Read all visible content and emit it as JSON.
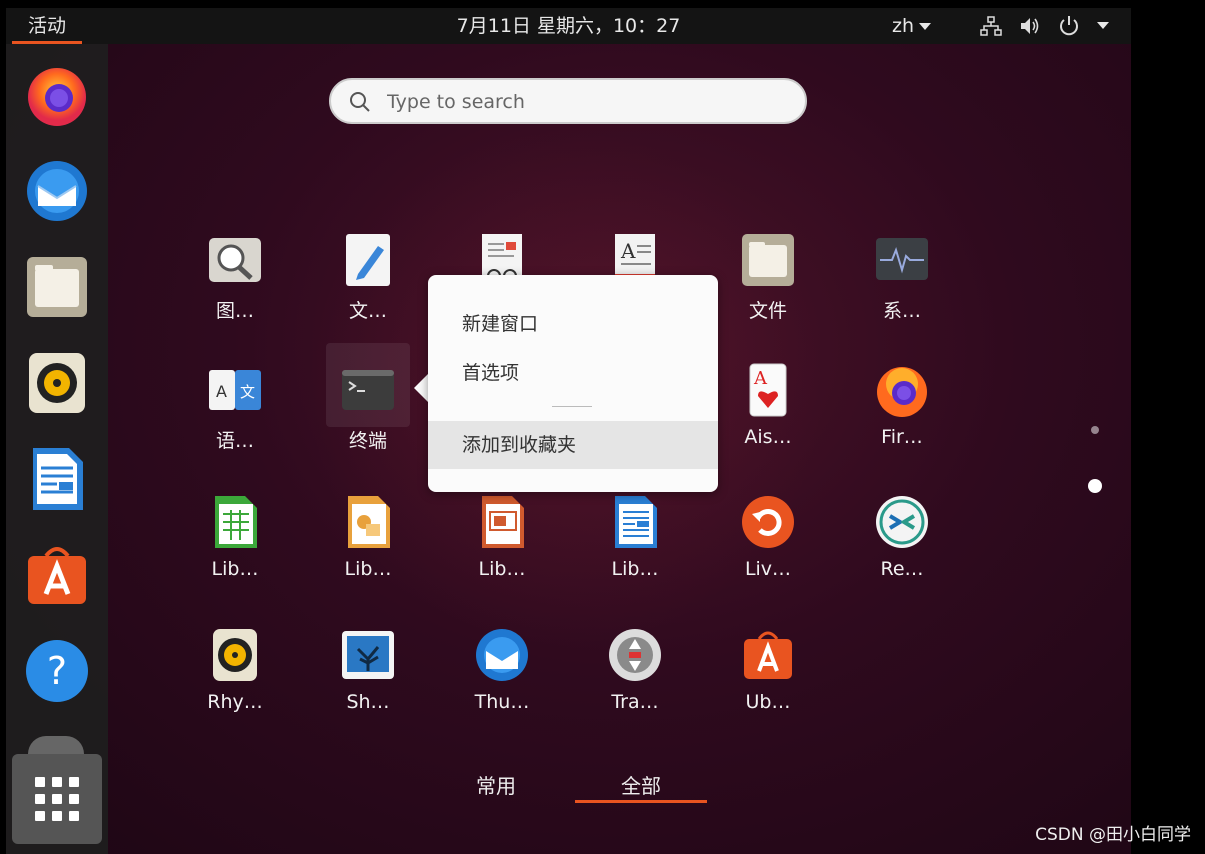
{
  "topbar": {
    "activities": "活动",
    "clock": "7月11日 星期六，10：27",
    "lang": "zh"
  },
  "search": {
    "placeholder": "Type to search"
  },
  "apps": [
    {
      "label": "图…",
      "icon": "image-viewer-icon"
    },
    {
      "label": "文…",
      "icon": "text-editor-icon"
    },
    {
      "label": "",
      "icon": "document-viewer-icon"
    },
    {
      "label": "",
      "icon": "dictionary-icon"
    },
    {
      "label": "文件",
      "icon": "files-icon"
    },
    {
      "label": "系…",
      "icon": "system-monitor-icon"
    },
    {
      "label": "语…",
      "icon": "language-support-icon"
    },
    {
      "label": "终端",
      "icon": "terminal-icon"
    },
    {
      "label": "Ais…",
      "icon": "aisleriot-cards-icon"
    },
    {
      "label": "Fir…",
      "icon": "firefox-icon"
    },
    {
      "label": "Lib…",
      "icon": "libreoffice-calc-icon"
    },
    {
      "label": "Lib…",
      "icon": "libreoffice-draw-icon"
    },
    {
      "label": "Lib…",
      "icon": "libreoffice-impress-icon"
    },
    {
      "label": "Lib…",
      "icon": "libreoffice-writer-icon"
    },
    {
      "label": "Liv…",
      "icon": "live-patch-icon"
    },
    {
      "label": "Re…",
      "icon": "remmina-icon"
    },
    {
      "label": "Rhy…",
      "icon": "rhythmbox-icon"
    },
    {
      "label": "Sh…",
      "icon": "shotwell-icon"
    },
    {
      "label": "Thu…",
      "icon": "thunderbird-icon"
    },
    {
      "label": "Tra…",
      "icon": "transmission-icon"
    },
    {
      "label": "Ub…",
      "icon": "ubuntu-software-icon"
    }
  ],
  "context_menu": {
    "items": [
      "新建窗口",
      "首选项",
      "添加到收藏夹"
    ],
    "highlighted": "添加到收藏夹"
  },
  "tabs": {
    "frequent": "常用",
    "all": "全部",
    "active": "all"
  },
  "watermark": "CSDN @田小白同学",
  "colors": {
    "accent": "#e95420",
    "topbar": "#141414",
    "dock": "#1e1e1e"
  }
}
